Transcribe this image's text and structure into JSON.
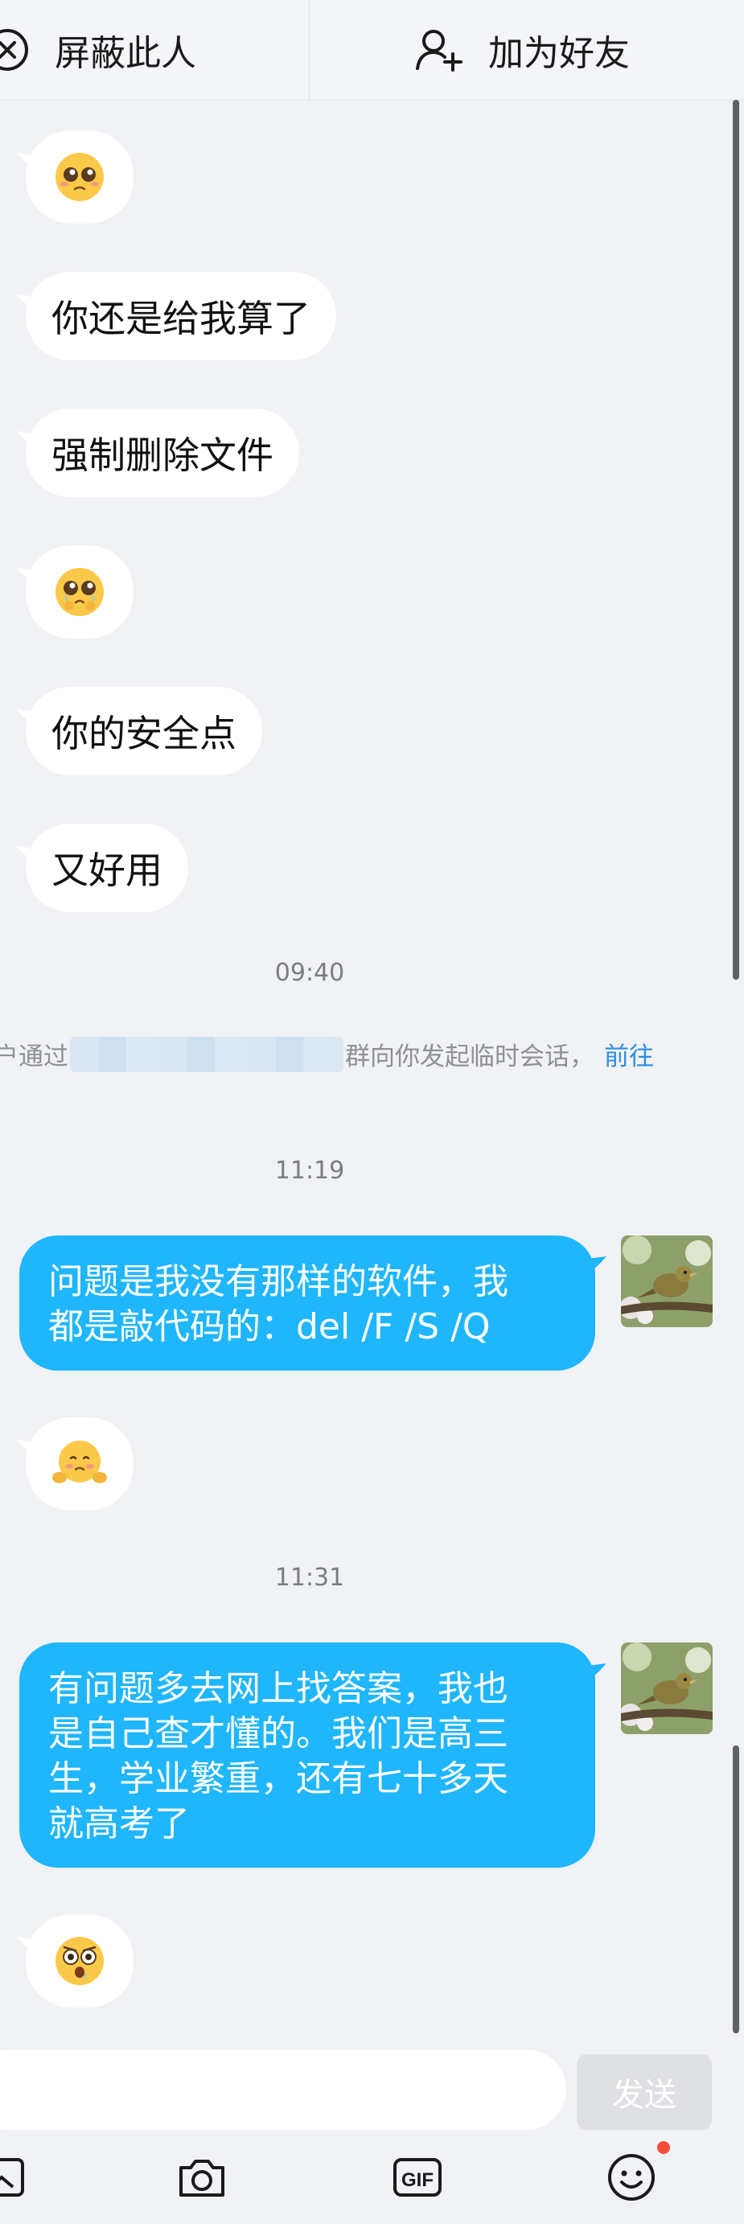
{
  "topbar": {
    "block_label": "屏蔽此人",
    "add_friend_label": "加为好友"
  },
  "messages": {
    "m1_emoji": "pleading-face-emoji",
    "m2_text": "你还是给我算了",
    "m3_text": "强制删除文件",
    "m4_emoji": "crying-pleading-emoji",
    "m5_text": "你的安全点",
    "m6_text": "又好用",
    "time1": "09:40",
    "notice_prefix": "户通过",
    "notice_suffix": "群向你发起临时会话，",
    "notice_link": "前往",
    "time2": "11:19",
    "sent1_line1": "问题是我没有那样的软件，我",
    "sent1_line2": "都是敲代码的：del /F /S /Q",
    "m7_emoji": "shy-face-emoji",
    "time3": "11:31",
    "sent2_line1": "有问题多去网上找答案，我也",
    "sent2_line2": "是自己查才懂的。我们是高三",
    "sent2_line3": "生，学业繁重，还有七十多天",
    "sent2_line4": "就高考了",
    "m8_emoji": "shocked-face-emoji"
  },
  "input": {
    "value": "",
    "send_label": "发送"
  },
  "toolbar": {
    "icons": [
      "image-icon",
      "camera-icon",
      "gif-icon",
      "emoji-icon"
    ]
  },
  "colors": {
    "background": "#f1f2f6",
    "sent_bubble": "#1fb6fb",
    "received_bubble": "#ffffff",
    "link": "#2d8fe0",
    "badge": "#f44f3c"
  }
}
